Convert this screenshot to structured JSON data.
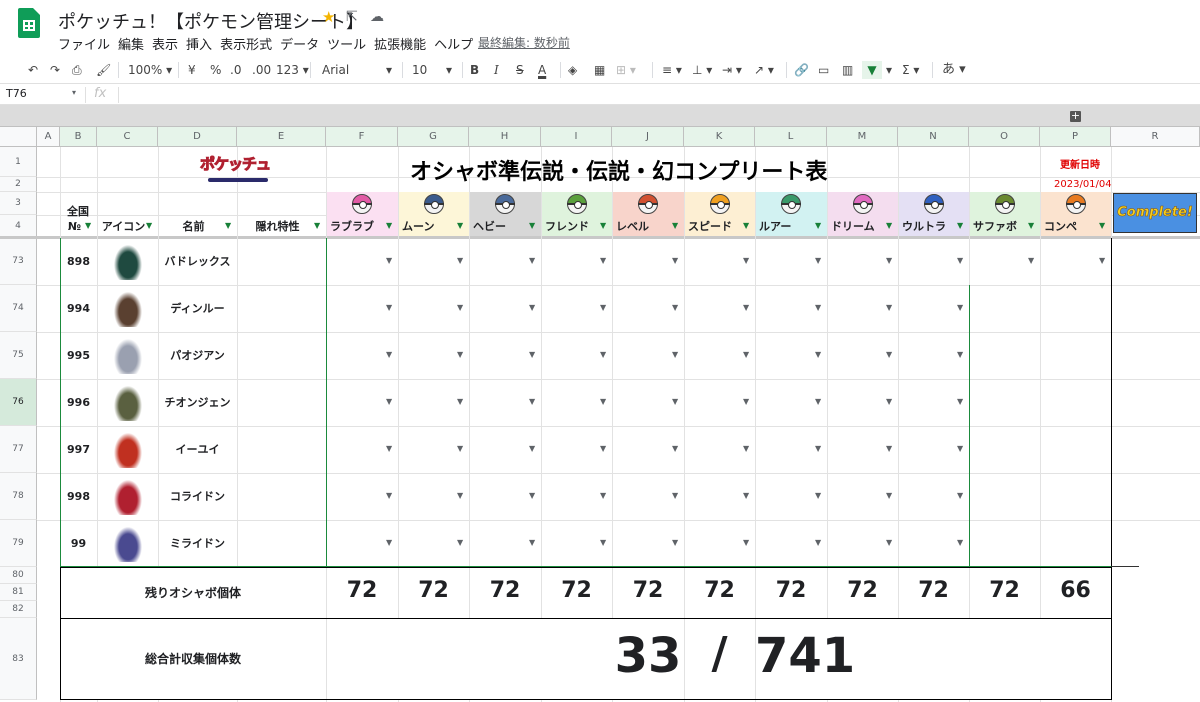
{
  "doc": {
    "title": "ポケッチュ！【ポケモン管理シート】",
    "last_edit": "最終編集: 数秒前"
  },
  "menu": [
    "ファイル",
    "編集",
    "表示",
    "挿入",
    "表示形式",
    "データ",
    "ツール",
    "拡張機能",
    "ヘルプ"
  ],
  "toolbar": {
    "zoom": "100%",
    "currency": "¥",
    "percent": "%",
    "dec_less": ".0",
    "dec_more": ".00",
    "format": "123",
    "font": "Arial",
    "size": "10",
    "bold": "B",
    "italic": "I",
    "strike": "S",
    "textcolor": "A",
    "input_tool": "あ"
  },
  "formula": {
    "cellref": "T76",
    "fx": "fx"
  },
  "columns": [
    "A",
    "B",
    "C",
    "D",
    "E",
    "F",
    "G",
    "H",
    "I",
    "J",
    "K",
    "L",
    "M",
    "N",
    "O",
    "P",
    "R"
  ],
  "rows": [
    "1",
    "2",
    "3",
    "4",
    "73",
    "74",
    "75",
    "76",
    "77",
    "78",
    "79",
    "80",
    "81",
    "82",
    "83"
  ],
  "sheet": {
    "logo_text": "ポケッチュ",
    "title": "オシャボ準伝説・伝説・幻コンプリート表",
    "updated_label": "更新日時",
    "updated_date": "2023/01/04",
    "zenkoku": "全国",
    "complete_badge": "Complete!",
    "headers": {
      "no": "№",
      "icon": "アイコン",
      "name": "名前",
      "ability": "隠れ特性"
    },
    "balls": [
      {
        "name": "ラブラブ",
        "bg": "#fbe0f2",
        "color": "#e25aa5"
      },
      {
        "name": "ムーン",
        "bg": "#fdf6d8",
        "color": "#3b5b8c"
      },
      {
        "name": "ヘビー",
        "bg": "#d7d7d7",
        "color": "#4a6a9a"
      },
      {
        "name": "フレンド",
        "bg": "#dff3dd",
        "color": "#5aa03c"
      },
      {
        "name": "レベル",
        "bg": "#f8d4cb",
        "color": "#d25030"
      },
      {
        "name": "スピード",
        "bg": "#fdefd3",
        "color": "#f0a020"
      },
      {
        "name": "ルアー",
        "bg": "#d2f2f2",
        "color": "#3a9a6a"
      },
      {
        "name": "ドリーム",
        "bg": "#f4ddef",
        "color": "#e06ac0"
      },
      {
        "name": "ウルトラ",
        "bg": "#e4e0f4",
        "color": "#3060c0"
      },
      {
        "name": "サファボ",
        "bg": "#dff3dd",
        "color": "#6a8a30"
      },
      {
        "name": "コンペ",
        "bg": "#fbe3cf",
        "color": "#e87a20"
      }
    ],
    "pokemon": [
      {
        "row": "73",
        "no": "898",
        "name": "バドレックス",
        "color": "#1f4a40"
      },
      {
        "row": "74",
        "no": "994",
        "name": "ディンルー",
        "color": "#5a4030"
      },
      {
        "row": "75",
        "no": "995",
        "name": "パオジアン",
        "color": "#9aa0b0"
      },
      {
        "row": "76",
        "no": "996",
        "name": "チオンジェン",
        "color": "#5a6040"
      },
      {
        "row": "77",
        "no": "997",
        "name": "イーユイ",
        "color": "#c03020"
      },
      {
        "row": "78",
        "no": "998",
        "name": "コライドン",
        "color": "#b02030"
      },
      {
        "row": "79",
        "no": "99",
        "name": "ミライドン",
        "color": "#4a4a90"
      }
    ],
    "remaining_label": "残りオシャボ個体",
    "remaining": [
      "72",
      "72",
      "72",
      "72",
      "72",
      "72",
      "72",
      "72",
      "72",
      "72",
      "66"
    ],
    "total_label": "総合計収集個体数",
    "total_collected": "33",
    "total_slash": "/",
    "total_all": "741"
  }
}
